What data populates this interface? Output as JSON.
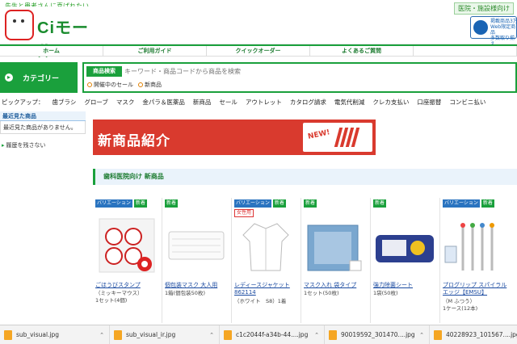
{
  "header": {
    "tagline": "先生と患者さんに喜ばれたい。",
    "logo_text": "Ciモール",
    "top_right_link": "医院・施設様向け",
    "right_box_text": "掲載商品3万\nWeb限定商品\n多数取り揃え"
  },
  "nav": {
    "items": [
      "ホーム",
      "ご利用ガイド",
      "クイックオーダー",
      "よくあるご質問",
      ""
    ]
  },
  "category": {
    "label": "カテゴリー"
  },
  "search": {
    "tag": "商品検索",
    "placeholder": "キーワード・商品コードから商品を検索",
    "opt1": "開催中のセール",
    "opt2": "新商品"
  },
  "pickup": {
    "label": "ピックアップ：",
    "links": [
      "歯ブラシ",
      "グローブ",
      "マスク",
      "金パラ＆医薬品",
      "新商品",
      "セール",
      "アウトレット",
      "カタログ請求",
      "電気代削減",
      "クレカ支払い",
      "口座振替",
      "コンビニ払い"
    ]
  },
  "sidebar": {
    "title": "最近見た商品",
    "empty": "最近見た商品がありません。",
    "history_link": "履歴を残さない"
  },
  "banner": {
    "text": "新商品紹介",
    "badge_new": "NEW!"
  },
  "section": {
    "title": "歯科医院向け 新商品"
  },
  "products": [
    {
      "tags": [
        "バリエーション",
        "新着"
      ],
      "name": "ごほうびスタンプ",
      "sub": "（ミッキーマウス）",
      "sub2": "1セット(4個)"
    },
    {
      "tags": [
        "新着"
      ],
      "name": "個包装マスク 大人用",
      "sub": "1箱(個包装50枚)",
      "sub2": ""
    },
    {
      "tags": [
        "バリエーション",
        "新着"
      ],
      "badge": "女性用",
      "name": "レディースジャケット 862114",
      "sub": "（ホワイト　S8）1着",
      "sub2": ""
    },
    {
      "tags": [
        "新着"
      ],
      "name": "マスク入れ 袋タイプ",
      "sub": "1セット(50枚)",
      "sub2": ""
    },
    {
      "tags": [
        "新着"
      ],
      "name": "強力除菌シート",
      "sub": "1袋(50枚)",
      "sub2": ""
    },
    {
      "tags": [
        "バリエーション",
        "新着"
      ],
      "name": "プログリップ スパイラルエッジ【EMSU】",
      "sub": "（M ふつう）",
      "sub2": "1ケース(12本)"
    }
  ],
  "downloads": [
    {
      "name": "sub_visual.jpg"
    },
    {
      "name": "sub_visual_ir.jpg"
    },
    {
      "name": "c1c2044f-a34b-44....jpg"
    },
    {
      "name": "90019592_301470....jpg"
    },
    {
      "name": "40228923_101567....jpg"
    }
  ],
  "colors": {
    "brand_green": "#1aa03c",
    "banner_red": "#d93a2e",
    "link_blue": "#1a4aa0",
    "variation_blue": "#2a74c0"
  }
}
